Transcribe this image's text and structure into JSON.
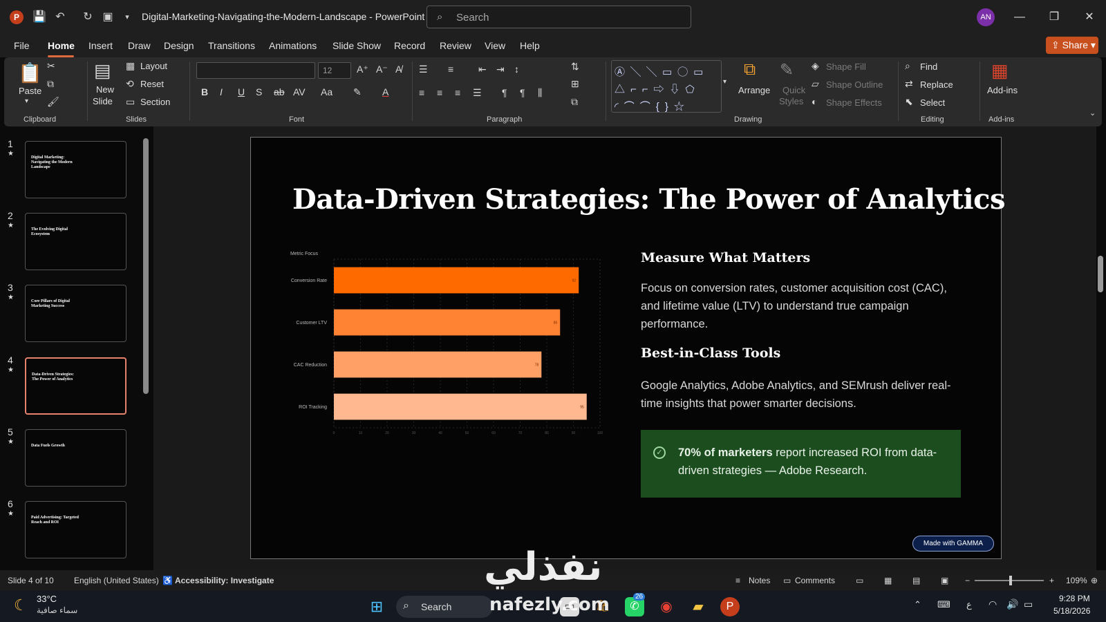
{
  "window": {
    "title": "Digital-Marketing-Navigating-the-Modern-Landscape  -  PowerPoint",
    "search_placeholder": "Search",
    "avatar_initials": "AN"
  },
  "menu": {
    "tabs": [
      "File",
      "Home",
      "Insert",
      "Draw",
      "Design",
      "Transitions",
      "Animations",
      "Slide Show",
      "Record",
      "Review",
      "View",
      "Help"
    ],
    "active": "Home",
    "share_label": "Share"
  },
  "ribbon": {
    "clipboard": {
      "paste": "Paste",
      "group": "Clipboard"
    },
    "slides": {
      "new_slide_line1": "New",
      "new_slide_line2": "Slide",
      "layout": "Layout",
      "reset": "Reset",
      "section": "Section",
      "group": "Slides"
    },
    "font": {
      "size": "12",
      "group": "Font"
    },
    "paragraph": {
      "group": "Paragraph"
    },
    "drawing": {
      "arrange": "Arrange",
      "quick_styles_1": "Quick",
      "quick_styles_2": "Styles",
      "shape_fill": "Shape Fill",
      "shape_outline": "Shape Outline",
      "shape_effects": "Shape Effects",
      "group": "Drawing"
    },
    "editing": {
      "find": "Find",
      "replace": "Replace",
      "select": "Select",
      "group": "Editing"
    },
    "addins": {
      "label": "Add-ins",
      "group": "Add-ins"
    }
  },
  "thumbnails": [
    {
      "num": "1",
      "title": "Digital Marketing: Navigating the Modern Landscape"
    },
    {
      "num": "2",
      "title": "The Evolving Digital Ecosystem"
    },
    {
      "num": "3",
      "title": "Core Pillars of Digital Marketing Success"
    },
    {
      "num": "4",
      "title": "Data-Driven Strategies: The Power of Analytics"
    },
    {
      "num": "5",
      "title": "Data Fuels Growth"
    },
    {
      "num": "6",
      "title": "Paid Advertising: Targeted Reach and ROI"
    }
  ],
  "slide": {
    "title": "Data-Driven Strategies: The Power of Analytics",
    "section1_heading": "Measure What Matters",
    "section1_text": "Focus on conversion rates, customer acquisition cost (CAC), and lifetime value (LTV) to understand true campaign performance.",
    "section2_heading": "Best-in-Class Tools",
    "section2_text": "Google Analytics, Adobe Analytics, and SEMrush deliver real-time insights that power smarter decisions.",
    "callout_bold": "70% of marketers",
    "callout_rest": " report increased ROI from data-driven strategies — Adobe Research.",
    "badge": "Made with GAMMA"
  },
  "chart_data": {
    "type": "bar",
    "orientation": "horizontal",
    "title": "Metric Focus",
    "categories": [
      "Conversion Rate",
      "Customer LTV",
      "CAC Reduction",
      "ROI Tracking"
    ],
    "values": [
      92,
      85,
      78,
      95
    ],
    "colors": [
      "#ff6a00",
      "#ff8333",
      "#ffa066",
      "#ffb890"
    ],
    "xlim": [
      0,
      100
    ],
    "x_ticks": [
      0,
      10,
      20,
      30,
      40,
      50,
      60,
      70,
      80,
      90,
      100
    ],
    "grid": true
  },
  "status": {
    "slide_info": "Slide 4 of 10",
    "language": "English (United States)",
    "accessibility": "Accessibility: Investigate",
    "notes": "Notes",
    "comments": "Comments",
    "zoom": "109%"
  },
  "taskbar": {
    "weather_temp": "33°C",
    "weather_desc": "سماء صافية",
    "search": "Search",
    "whatsapp_badge": "26",
    "time": "9:28 PM",
    "date": "5/18/2026",
    "lang": "ع"
  },
  "watermark": {
    "arabic": "نفذلي",
    "latin": "nafezly.com"
  }
}
